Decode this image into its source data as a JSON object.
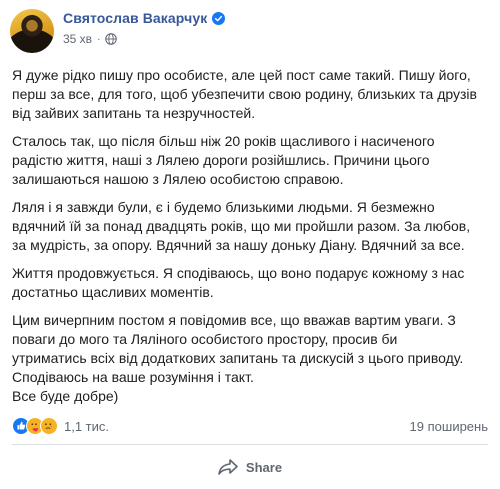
{
  "post": {
    "author": "Святослав Вакарчук",
    "time": "35 хв",
    "separator": "·",
    "paragraphs": [
      [
        "Я дуже рідко пишу про особисте, але цей пост саме такий. Пишу його,",
        "перш за все, для того, щоб убезпечити свою родину, близьких та друзів",
        "від зайвих запитань та незручностей."
      ],
      [
        "Сталось так, що після більш ніж 20 років щасливого і насиченого",
        "радістю життя, наші з Лялею дороги розійшлись. Причини цього",
        "залишаються нашою з Лялею особистою справою."
      ],
      [
        "Ляля і я завжди були, є і будемо близькими людьми. Я безмежно",
        "вдячний їй за понад двадцять років, що ми пройшли разом. За любов,",
        "за мудрість, за опору. Вдячний за нашу доньку Діану. Вдячний за все."
      ],
      [
        "Життя продовжується. Я сподіваюсь, що воно подарує кожному з нас",
        "достатньо щасливих моментів."
      ],
      [
        "Цим вичерпним постом я повідомив все, що вважав вартим уваги. З",
        "поваги до мого та Ляліного особистого простору, просив би",
        "утриматись всіх від додаткових запитань та дискусій з цього приводу.",
        "Сподіваюсь на ваше розуміння і такт.",
        "Все буде добре)"
      ]
    ]
  },
  "reactions": {
    "count": "1,1 тис.",
    "icons": [
      "like-icon",
      "care-icon",
      "sad-icon"
    ],
    "like_color": "#1877f2",
    "emoji_color": "#f7b125"
  },
  "shares": "19 поширень",
  "actions": {
    "share_label": "Share"
  },
  "colors": {
    "author": "#385898",
    "meta": "#606770",
    "text": "#1c1e21"
  }
}
